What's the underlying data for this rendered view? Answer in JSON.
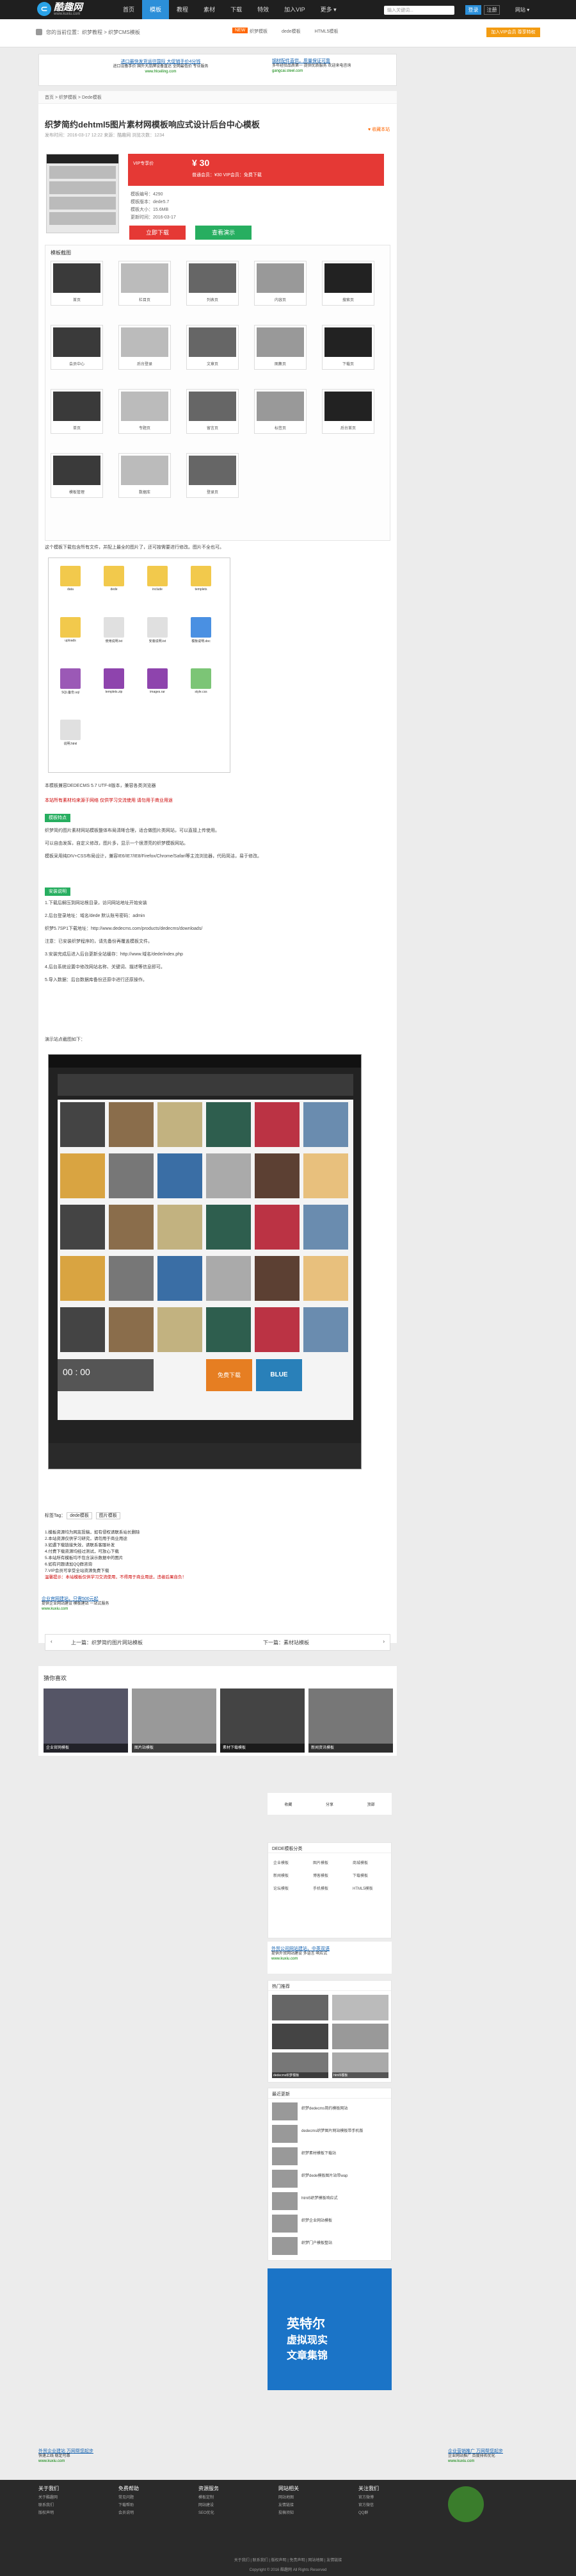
{
  "nav": {
    "logo_name": "酷趣网",
    "logo_sub": "www.kuxiu.com",
    "items": [
      "首页",
      "模板",
      "教程",
      "素材",
      "下载",
      "特效",
      "加入VIP",
      "更多 ▾"
    ],
    "search_placeholder": "输入关键词...",
    "login": "登录",
    "register": "注册",
    "more": "网站 ▾"
  },
  "subbar": {
    "crumb": "您的当前位置：织梦教程 > 织梦CMS模板",
    "tag_new": "NEW",
    "hot": [
      "织梦模板",
      "dede模板",
      "HTML5模板"
    ],
    "apply": "加入VIP会员 尊享特权"
  },
  "ads": {
    "top_left": {
      "title": "进口最快发货运往国际 大促销手价4分钱",
      "text": "进口设备手价 国外大品牌设备直达 全网最低价 专业服务",
      "url": "www.hlceiling.com"
    },
    "top_right": {
      "title": "钢材配件直供，质量保证可靠",
      "text": "多年经验品质第一 提供优质服务 欢迎来电咨询",
      "url": "gangcai.steel.com"
    },
    "mid_left": {
      "title": "企业官网建站，只需500元起",
      "text": "提供企业网站建设 模板建站 一站式服务",
      "url": "www.kuxiu.com"
    },
    "bot_left": {
      "title": "外贸企业建站 万网帮您起步",
      "text": "快速上线 稳定可靠",
      "url": "www.kuxiu.com"
    },
    "bot_right": {
      "title": "企业营销推广 万网帮您起步",
      "text": "企业网站推广 百度排名优化",
      "url": "www.kuxiu.com"
    },
    "side": {
      "title": "外贸公司网站建站，中英双语",
      "text": "提供外贸网站建设 多语言 响应式",
      "url": "www.kuxiu.com"
    }
  },
  "article": {
    "crumbline": "首页 > 织梦模板 > Dede模板",
    "title": "织梦简约dehtml5图片素材网模板响应式设计后台中心模板",
    "meta": "发布时间：2016-03-17 12:22  来源：酷趣网  浏览次数：1234",
    "fav": "♥ 收藏本站",
    "price_label": "VIP专享价",
    "price": "¥ 30",
    "price_note": "限时优惠",
    "vip_note": "普通会员：¥30    VIP会员：免费下载",
    "info": [
      "模板编号：4290",
      "模板版本：dede5.7",
      "模板大小：15.6MB",
      "更新时间：2016-03-17"
    ],
    "btn_dl": "立即下载",
    "btn_other": "查看演示",
    "gallery_title": "模板截图",
    "gallery_caps": [
      "首页",
      "栏目页",
      "列表页",
      "内容页",
      "搜索页",
      "会员中心",
      "后台登录",
      "文章页",
      "图集页",
      "下载页",
      "单页",
      "专题页",
      "留言页",
      "标签页",
      "后台首页",
      "模板管理",
      "数据库",
      "登录页"
    ],
    "p1": "这个模板下载包含所有文件，并配上最全的图片了，还可按需要进行修改。图片不全也可。",
    "files": [
      "data",
      "dede",
      "include",
      "templets",
      "uploads",
      "使用说明.txt",
      "安装说明.txt",
      "模板说明.doc",
      "SQL备份.sql",
      "templets.zip",
      "images.rar",
      "style.css",
      "说明.html"
    ],
    "p2": "本模板兼容DEDECMS 5.7 UTF-8版本，兼容各类浏览器",
    "p3": "本站所有素材均来源于网络 仅供学习交流使用 请勿用于商业用途",
    "sec1": "模板特点",
    "p4": "织梦简约图片素材网站模板整体布局清晰合理，适合做图片类网站，可以直接上传使用。",
    "p5": "可以自由发挥，自定义修改，图片多，显示一个很漂亮的织梦模板网站。",
    "p6": "模板采用纯DIV+CSS布局设计，兼容IE6/IE7/IE8/Firefox/Chrome/Safari等主流浏览器，代码简洁，易于修改。",
    "sec2": "安装说明",
    "steps": [
      "1.下载后解压到网站根目录，访问网站地址开始安装",
      "2.后台登录地址：域名/dede  默认账号密码：admin",
      "织梦5.7SP1下载地址：http://www.dedecms.com/products/dedecms/downloads/",
      "注意：已安装织梦程序的，请先备份再覆盖模板文件。",
      "3.安装完成后进入后台更新全站缓存：http://www.域名/dede/index.php",
      "4.后台系统设置中修改网站名称、关键词、描述等信息即可。",
      "5.导入数据：后台数据库备份还原中进行还原操作。"
    ],
    "p7": "演示站点截图如下：",
    "ws_dl": "免费下载",
    "ws_blue": "BLUE",
    "ws_time": "00 : 00",
    "tags_label": "标签Tag：",
    "tags": [
      "dede模板",
      "图片模板"
    ],
    "notes": [
      "1.模板资源均为网友投稿，如有侵权请联系站长删除",
      "2.本站资源仅供学习研究，请勿用于商业用途",
      "3.如遇下载链接失效，请联系客服补发",
      "4.付费下载资源均经过测试，可放心下载",
      "5.本站所有模板均不包含演示数据中的图片",
      "6.如有问题请加QQ群咨询",
      "7.VIP会员可享受全站资源免费下载"
    ],
    "notes_warn": "温馨提示：本站模板仅供学习交流使用，不得用于商业用途，违者后果自负！",
    "prev": "上一篇：织梦简约图片网站模板",
    "next": "下一篇：素材站模板",
    "rel_title": "猜你喜欢",
    "rel_caps": [
      "企业官网模板",
      "图片站模板",
      "素材下载模板",
      "新闻资讯模板"
    ]
  },
  "sidebar": {
    "icons": [
      "收藏",
      "分享",
      "顶部"
    ],
    "box1": "DEDE模板分类",
    "box1_items": [
      "企业模板",
      "图片模板",
      "商城模板",
      "新闻模板",
      "博客模板",
      "下载模板",
      "论坛模板",
      "手机模板",
      "HTML5模板"
    ],
    "box2": "热门推荐",
    "box2_caps": [
      "dedecms织梦模板",
      "html5模板"
    ],
    "box3": "最近更新",
    "box3_items": [
      "织梦dedecms简约模板网站",
      "dedecms织梦图片网站模板带手机版",
      "织梦素材模板下载站",
      "织梦dede模板图片站带wap",
      "html5织梦模板响应式",
      "织梦企业网站模板",
      "织梦门户模板整站"
    ],
    "side_ad_title": "英特尔",
    "side_ad_sub": "虚拟现实",
    "side_ad_sub2": "文章集锦"
  },
  "footer": {
    "cols": [
      {
        "h": "关于我们",
        "items": [
          "关于酷趣网",
          "联系我们",
          "版权声明"
        ]
      },
      {
        "h": "免费帮助",
        "items": [
          "常见问题",
          "下载帮助",
          "会员说明"
        ]
      },
      {
        "h": "资源服务",
        "items": [
          "模板定制",
          "网站建设",
          "SEO优化"
        ]
      },
      {
        "h": "网站相关",
        "items": [
          "网站地图",
          "友情链接",
          "投稿须知"
        ]
      },
      {
        "h": "关注我们",
        "items": [
          "官方微博",
          "官方微信",
          "QQ群"
        ]
      }
    ],
    "links": "关于我们 | 联系我们 | 版权声明 | 免责声明 | 网站地图 | 友情链接",
    "copyright": "Copyright © 2016 酷趣网 All Rights Reserved"
  }
}
